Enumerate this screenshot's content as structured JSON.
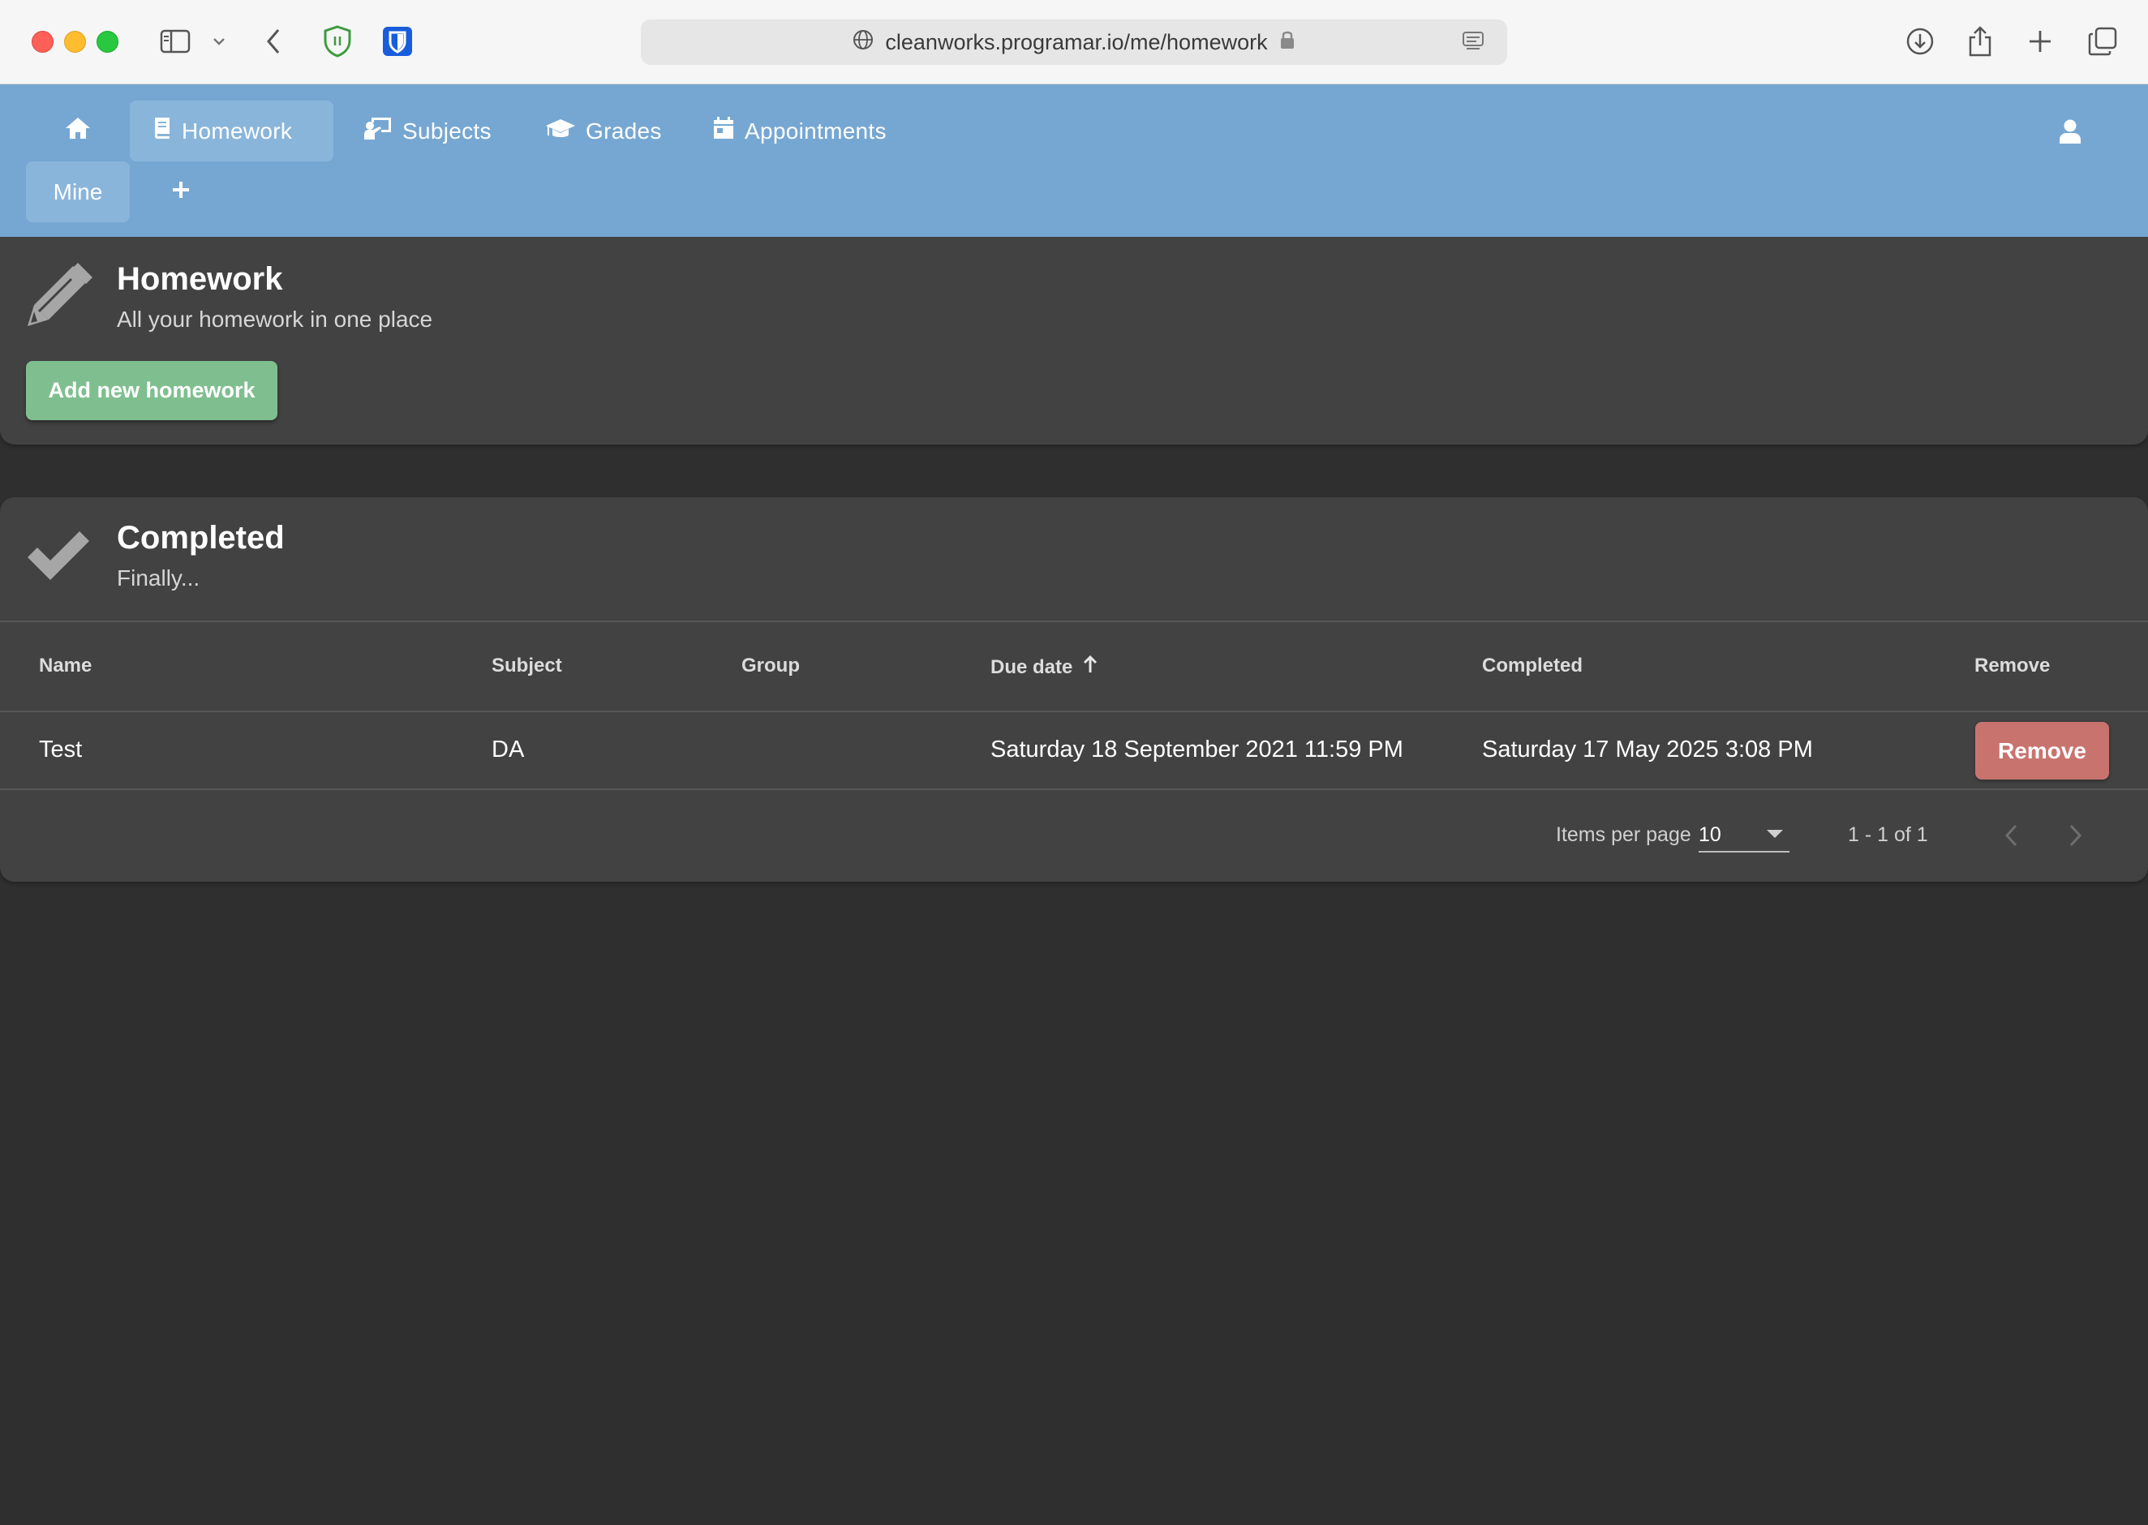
{
  "browser": {
    "url": "cleanworks.programar.io/me/homework"
  },
  "nav": {
    "items": [
      {
        "label": "Homework"
      },
      {
        "label": "Subjects"
      },
      {
        "label": "Grades"
      },
      {
        "label": "Appointments"
      }
    ],
    "sub": {
      "mine_label": "Mine"
    }
  },
  "homework_card": {
    "title": "Homework",
    "subtitle": "All your homework in one place",
    "add_button": "Add new homework"
  },
  "completed_card": {
    "title": "Completed",
    "subtitle": "Finally...",
    "columns": [
      "Name",
      "Subject",
      "Group",
      "Due date",
      "Completed",
      "Remove"
    ],
    "rows": [
      {
        "name": "Test",
        "subject": "DA",
        "group": "",
        "due_date": "Saturday 18 September 2021 11:59 PM",
        "completed": "Saturday 17 May 2025 3:08 PM",
        "remove_label": "Remove"
      }
    ],
    "pager": {
      "items_per_page_label": "Items per page",
      "items_per_page_value": "10",
      "range": "1 - 1 of 1"
    }
  },
  "colors": {
    "appbar": "#76a7d2",
    "add_button": "#7fbf8f",
    "remove_button": "#c9736f",
    "card": "#424242",
    "background": "#2f2f2f"
  }
}
